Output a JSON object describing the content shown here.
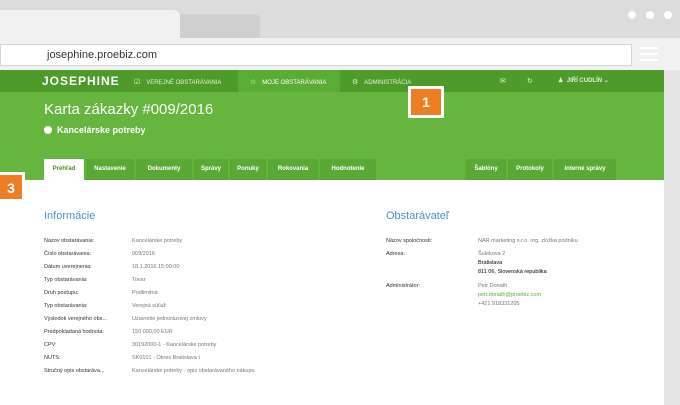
{
  "browser": {
    "url": "josephine.proebiz.com"
  },
  "nav": {
    "logo": "JOSEPHINE",
    "items": [
      {
        "label": "VEREJNÉ OBSTARÁVANIA",
        "icon": "☑"
      },
      {
        "label": "MOJE OBSTARÁVANIA",
        "icon": "☆"
      },
      {
        "label": "ADMINISTRÁCIA",
        "icon": "⚙"
      }
    ],
    "user": "JIŘÍ CUDLÍN"
  },
  "header": {
    "title": "Karta zákazky #009/2016",
    "subtitle": "Kancelárske potreby"
  },
  "tabs": {
    "left": [
      "Prehľad",
      "Nastavenie",
      "Dokumenty",
      "Správy",
      "Ponuky",
      "Rokovania",
      "Hodnotenie"
    ],
    "right": [
      "Šablóny",
      "Protokoly",
      "Interné správy"
    ]
  },
  "annotations": {
    "badge1": "1",
    "badge3": "3"
  },
  "info": {
    "title": "Informácie",
    "rows": [
      {
        "label": "Názov obstarávania:",
        "value": "Kancelárske potreby"
      },
      {
        "label": "Číslo obstarávania:",
        "value": "009/2016"
      },
      {
        "label": "Dátum uverejnenia:",
        "value": "18.1.2016 15:00:00"
      },
      {
        "label": "Typ obstarávania:",
        "value": "Tovar"
      },
      {
        "label": "Druh postupu:",
        "value": "Podlimitná"
      },
      {
        "label": "Typ obstarávania:",
        "value": "Verejná súťaž"
      },
      {
        "label": "Výsledok verejného obs...",
        "value": "Uzavretie jednorázovej zmluvy"
      },
      {
        "label": "Predpokladaná hodnota:",
        "value": "150 000,00 EUR"
      },
      {
        "label": "CPV:",
        "value": "30192000-1 - Kancelárske potreby"
      },
      {
        "label": "NUTS:",
        "value": "SK0101 - Okres Bratislava I"
      },
      {
        "label": "Stručný opis obstaráva...",
        "value": "Kancelárske potreby - opis obstarávaného nákupu"
      }
    ]
  },
  "buyer": {
    "title": "Obstarávateľ",
    "company_label": "Názov spoločnosti:",
    "company_value": "NAR marketing s.r.o. org. zložka podniku",
    "address_label": "Adresa:",
    "address_lines": [
      "Šulekova 2",
      "Bratislava",
      "811 06, Slovenská republika"
    ],
    "admin_label": "Administrátor:",
    "admin_name": "Petr Donath",
    "admin_email": "petr.donath@proebiz.com",
    "admin_phone": "+421 918331205"
  }
}
